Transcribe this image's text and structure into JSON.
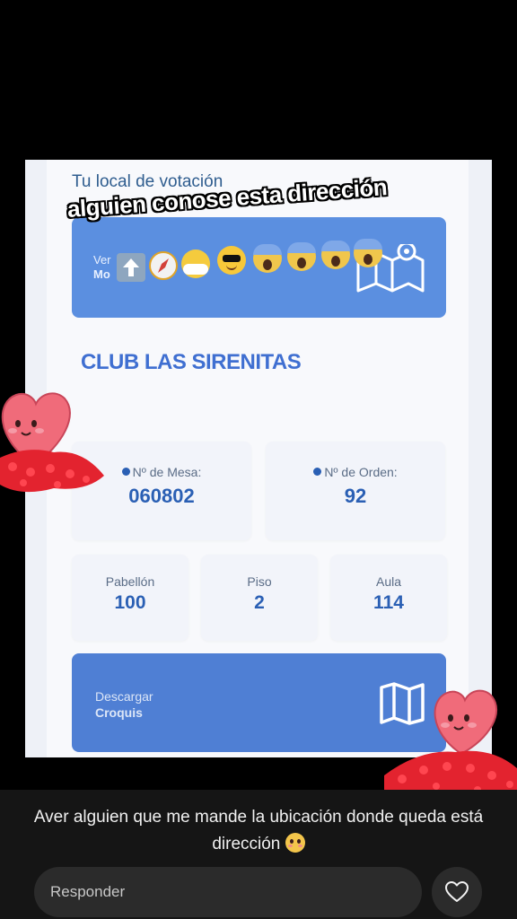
{
  "screenshot": {
    "local_title": "Tu local de votación",
    "banner_line1": "Ver",
    "banner_line2": "Mo",
    "club": "CLUB LAS SIRENITAS",
    "mesa_label": "Nº de Mesa:",
    "mesa_value": "060802",
    "orden_label": "Nº de Orden:",
    "orden_value": "92",
    "pabellon_label": "Pabellón",
    "pabellon_value": "100",
    "piso_label": "Piso",
    "piso_value": "2",
    "aula_label": "Aula",
    "aula_value": "114",
    "download_line1": "Descargar",
    "download_line2": "Croquis"
  },
  "overlay": {
    "caption": "alguien conose esta dirección",
    "emojis": [
      "arrow-up-icon",
      "compass-icon",
      "sun-behind-cloud-icon",
      "sunglasses-face-icon",
      "screaming-face-icon",
      "screaming-face-icon",
      "screaming-face-icon",
      "screaming-face-icon"
    ]
  },
  "comment": {
    "text": "Aver alguien que me mande la ubicación donde queda está dirección",
    "emoji": "flushed-face-icon"
  },
  "reply": {
    "placeholder": "Responder"
  },
  "colors": {
    "accent": "#5b8fe0",
    "value_blue": "#2a5fb4",
    "club_blue": "#3f6fd1",
    "heart": "#f06b7a"
  }
}
